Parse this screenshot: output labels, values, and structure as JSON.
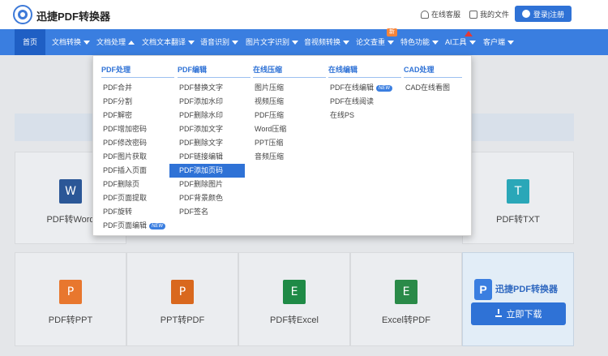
{
  "header": {
    "brand": "迅捷PDF转换器",
    "links": [
      {
        "label": "在线客服",
        "icon": "headset-icon"
      },
      {
        "label": "我的文件",
        "icon": "file-icon"
      }
    ],
    "login_label": "登录|注册"
  },
  "nav": {
    "items": [
      {
        "label": "首页"
      },
      {
        "label": "文档转换"
      },
      {
        "label": "文档处理"
      },
      {
        "label": "文档文本翻译"
      },
      {
        "label": "语音识别"
      },
      {
        "label": "图片文字识别"
      },
      {
        "label": "音视频转换"
      },
      {
        "label": "论文查重"
      },
      {
        "label": "特色功能"
      },
      {
        "label": "AI工具"
      },
      {
        "label": "客户端"
      }
    ],
    "badge_new": "新",
    "active_color": "#1f5fc4",
    "bar_color": "#3a7ee0"
  },
  "dropdown": {
    "columns": [
      {
        "heading": "PDF处理",
        "items": [
          "PDF合并",
          "PDF分割",
          "PDF解密",
          "PDF增加密码",
          "PDF修改密码",
          "PDF图片获取",
          "PDF插入页面",
          "PDF删除页",
          "PDF页面提取",
          "PDF旋转",
          "PDF页面编辑"
        ]
      },
      {
        "heading": "PDF编辑",
        "items": [
          "PDF替换文字",
          "PDF添加水印",
          "PDF删除水印",
          "PDF添加文字",
          "PDF删除文字",
          "PDF链接编辑",
          "PDF添加页码",
          "PDF删除图片",
          "PDF背景颜色",
          "PDF签名"
        ]
      },
      {
        "heading": "在线压缩",
        "items": [
          "图片压缩",
          "视频压缩",
          "PDF压缩",
          "Word压缩",
          "PPT压缩",
          "音频压缩"
        ]
      },
      {
        "heading": "在线编辑",
        "items": [
          "PDF在线编辑",
          "PDF在线阅读",
          "在线PS"
        ]
      },
      {
        "heading": "CAD处理",
        "items": [
          "CAD在线看图"
        ]
      }
    ],
    "new_tag": "NEW",
    "highlight_color": "#2f72d6"
  },
  "tools": [
    {
      "label": "PDF转Word",
      "icon": "word-icon",
      "glyph": "W",
      "color": "#2b5797"
    },
    {
      "label": "PDF转TXT",
      "icon": "txt-icon",
      "glyph": "T",
      "color": "#2aa7b8"
    },
    {
      "label": "PDF转PPT",
      "icon": "ppt-icon",
      "glyph": "P",
      "color": "#e8772e"
    },
    {
      "label": "PPT转PDF",
      "icon": "ppt-to-pdf-icon",
      "glyph": "P",
      "color": "#d9681e"
    },
    {
      "label": "PDF转Excel",
      "icon": "excel-icon",
      "glyph": "E",
      "color": "#1f8a46"
    },
    {
      "label": "Excel转PDF",
      "icon": "excel-to-pdf-icon",
      "glyph": "E",
      "color": "#2a8a48"
    }
  ],
  "promo": {
    "logo_glyph": "P",
    "title": "迅捷PDF转换器",
    "download_label": "立即下载"
  }
}
